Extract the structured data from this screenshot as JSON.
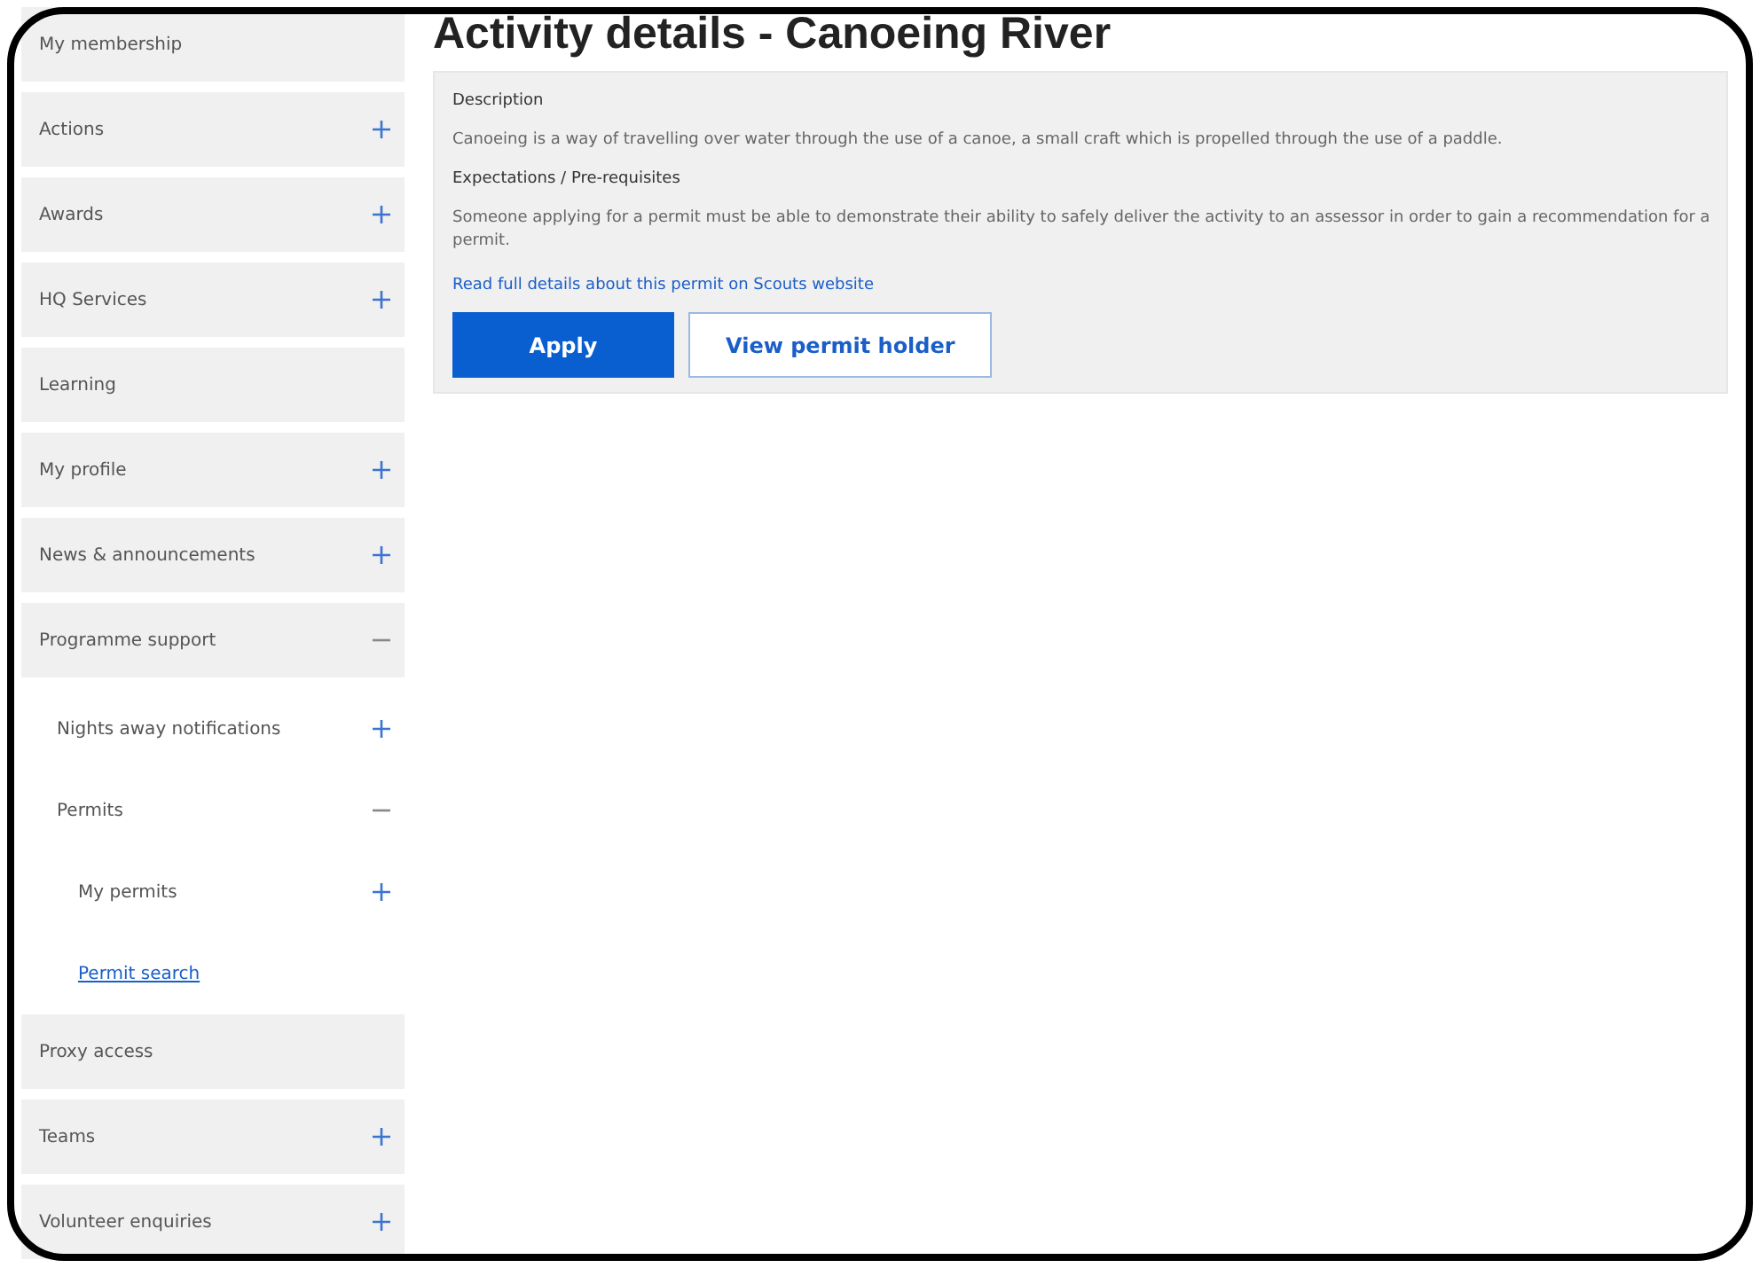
{
  "sidebar": {
    "items": [
      {
        "label": "My membership",
        "selected": false
      },
      {
        "label": "Actions",
        "expanded": false,
        "selected": false
      },
      {
        "label": "Awards",
        "expanded": false,
        "selected": false
      },
      {
        "label": "HQ Services",
        "expanded": false,
        "selected": false
      },
      {
        "label": "Learning",
        "selected": false
      },
      {
        "label": "My profile",
        "expanded": false,
        "selected": false
      },
      {
        "label": "News & announcements",
        "expanded": false,
        "selected": false
      },
      {
        "label": "Programme support",
        "expanded": true,
        "selected": false,
        "children": [
          {
            "label": "Nights away notifications",
            "expanded": false,
            "selected": false
          },
          {
            "label": "Permits",
            "expanded": true,
            "selected": false,
            "children": [
              {
                "label": "My permits",
                "expanded": false,
                "selected": false
              },
              {
                "label": "Permit search",
                "selected": true
              }
            ]
          }
        ]
      },
      {
        "label": "Proxy access",
        "selected": false
      },
      {
        "label": "Teams",
        "expanded": false,
        "selected": false
      },
      {
        "label": "Volunteer enquiries",
        "expanded": false,
        "selected": false
      }
    ]
  },
  "page": {
    "title": "Activity details - Canoeing River",
    "sections": [
      {
        "heading": "Description",
        "text": "Canoeing is a way of travelling over water through the use of a canoe, a small craft which is propelled through the use of a paddle."
      },
      {
        "heading": "Expectations / Pre-requisites",
        "text": "Someone applying for a permit must be able to demonstrate their ability to safely deliver the activity to an assessor in order to gain a recommendation for a permit."
      }
    ],
    "link": "Read full details about this permit on Scouts website",
    "buttons": [
      {
        "label": "Apply",
        "kind": "primary"
      },
      {
        "label": "View permit holder",
        "kind": "outline"
      }
    ]
  }
}
